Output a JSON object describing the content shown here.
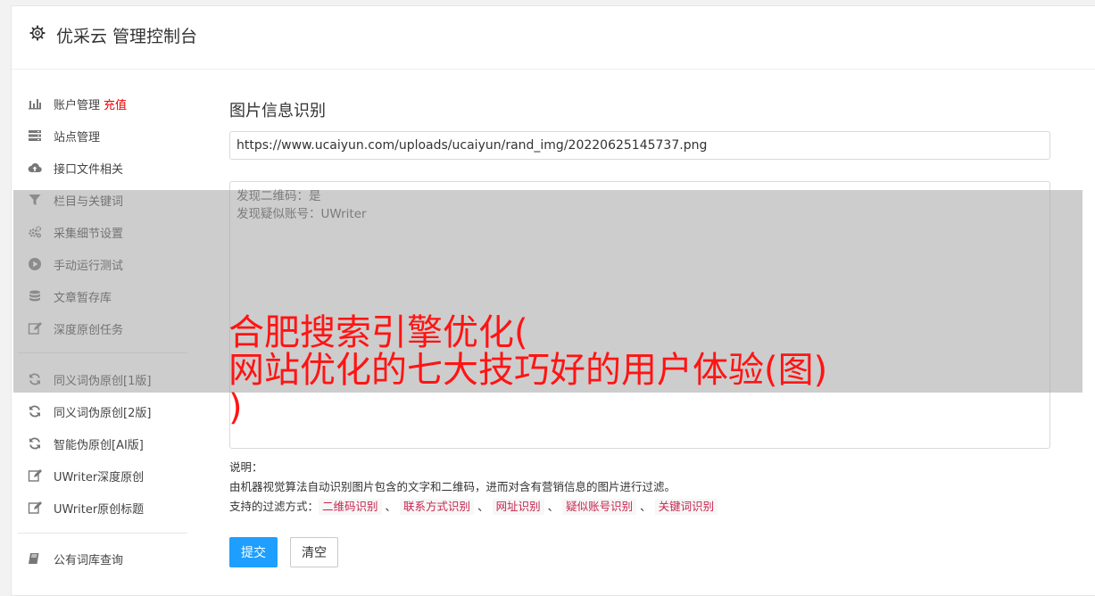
{
  "header": {
    "title": "优采云 管理控制台"
  },
  "sidebar": {
    "group1": [
      {
        "label": "账户管理",
        "badge": "充值",
        "icon": "bar-chart-icon"
      },
      {
        "label": "站点管理",
        "icon": "server-icon"
      },
      {
        "label": "接口文件相关",
        "icon": "cloud-upload-icon"
      },
      {
        "label": "栏目与关键词",
        "icon": "filter-icon"
      },
      {
        "label": "采集细节设置",
        "icon": "cogs-icon"
      },
      {
        "label": "手动运行测试",
        "icon": "play-circle-icon"
      },
      {
        "label": "文章暂存库",
        "icon": "database-icon"
      },
      {
        "label": "深度原创任务",
        "icon": "edit-icon"
      }
    ],
    "group2": [
      {
        "label": "同义词伪原创[1版]",
        "icon": "refresh-icon"
      },
      {
        "label": "同义词伪原创[2版]",
        "icon": "refresh-icon"
      },
      {
        "label": "智能伪原创[AI版]",
        "icon": "refresh-icon"
      },
      {
        "label": "UWriter深度原创",
        "icon": "edit-icon"
      },
      {
        "label": "UWriter原创标题",
        "icon": "edit-icon"
      }
    ],
    "group3": [
      {
        "label": "公有词库查询",
        "icon": "book-icon"
      }
    ]
  },
  "main": {
    "title": "图片信息识别",
    "url_value": "https://www.ucaiyun.com/uploads/ucaiyun/rand_img/20220625145737.png",
    "results": [
      "发现二维码：是",
      "发现疑似账号：UWriter"
    ],
    "desc_label": "说明：",
    "desc_text": "由机器视觉算法自动识别图片包含的文字和二维码，进而对含有营销信息的图片进行过滤。",
    "filter_label": "支持的过滤方式：",
    "filters": [
      "二维码识别",
      "联系方式识别",
      "网址识别",
      "疑似账号识别",
      "关键词识别"
    ],
    "filter_separator": "、",
    "submit_label": "提交",
    "clear_label": "清空"
  },
  "overlay": {
    "headline": "合肥搜索引擎优化(\n网站优化的七大技巧好的用户体验(图)\n)"
  },
  "colors": {
    "accent": "#1e9fff",
    "badge": "#ee0000",
    "tag": "#c7254e",
    "headline": "#ff1414"
  }
}
